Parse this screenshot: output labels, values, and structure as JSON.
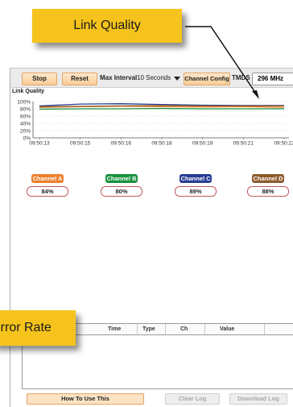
{
  "callouts": {
    "top": "Link Quality",
    "side": "Error Rate"
  },
  "toolbar": {
    "stop_label": "Stop",
    "reset_label": "Reset",
    "max_interval_label": "Max Interval",
    "max_interval_value": "10 Seconds",
    "channel_config_label": "Channel Config",
    "tmds_label": "TMDS",
    "tmds_value": "296 MHz"
  },
  "section_title": "Link Quality",
  "chart_data": {
    "type": "line",
    "categories": [
      "09:50:13",
      "09:50:15",
      "09:50:16",
      "09:50:18",
      "09:50:19",
      "09:50:21",
      "09:50:22"
    ],
    "y_ticks": [
      "100%",
      "80%",
      "60%",
      "40%",
      "20%",
      "0%"
    ],
    "ylim": [
      0,
      100
    ],
    "grid": true,
    "series": [
      {
        "name": "Channel A",
        "color": "#ee7f2d",
        "values": [
          84,
          86,
          87,
          86,
          85,
          86,
          84
        ]
      },
      {
        "name": "Channel B",
        "color": "#18913f",
        "values": [
          79,
          80,
          80,
          81,
          80,
          80,
          80
        ]
      },
      {
        "name": "Channel C",
        "color": "#263d93",
        "values": [
          88,
          93,
          94,
          92,
          90,
          89,
          89
        ]
      },
      {
        "name": "Channel D",
        "color": "#8c5a2b",
        "values": [
          86,
          87,
          88,
          89,
          88,
          88,
          88
        ]
      }
    ]
  },
  "channels": [
    {
      "name": "Channel A",
      "value": "84%",
      "color": "#ee7f2d"
    },
    {
      "name": "Channel B",
      "value": "80%",
      "color": "#18913f"
    },
    {
      "name": "Channel C",
      "value": "89%",
      "color": "#263d93"
    },
    {
      "name": "Channel D",
      "value": "88%",
      "color": "#8c5a2b"
    }
  ],
  "log": {
    "columns": [
      "Time",
      "Type",
      "Ch",
      "Value"
    ]
  },
  "buttons": {
    "how_to": "How To Use This",
    "clear_log": "Clear Log",
    "download_log": "Download Log"
  },
  "colors": {
    "callout": "#f5c31c",
    "button_orange": "#f9cd97"
  }
}
